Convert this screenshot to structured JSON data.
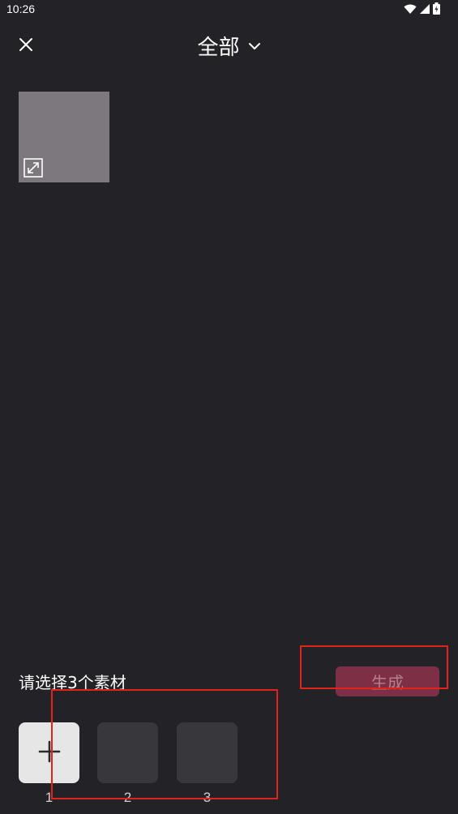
{
  "status_bar": {
    "time": "10:26",
    "icons": [
      "wifi-icon",
      "signal-icon",
      "battery-icon"
    ]
  },
  "header": {
    "close_icon": "close-icon",
    "title": "全部",
    "dropdown_icon": "chevron-down-icon"
  },
  "gallery": {
    "items": [
      {
        "icon": "expand-icon",
        "color": "#7d787d"
      }
    ]
  },
  "footer": {
    "prompt": "请选择3个素材",
    "generate_label": "生成",
    "accent_color": "#7d2f45",
    "slots": [
      {
        "label": "1",
        "type": "add",
        "icon": "plus-icon"
      },
      {
        "label": "2",
        "type": "empty"
      },
      {
        "label": "3",
        "type": "empty"
      }
    ]
  },
  "colors": {
    "background": "#232227",
    "annotation": "#e0241c"
  }
}
